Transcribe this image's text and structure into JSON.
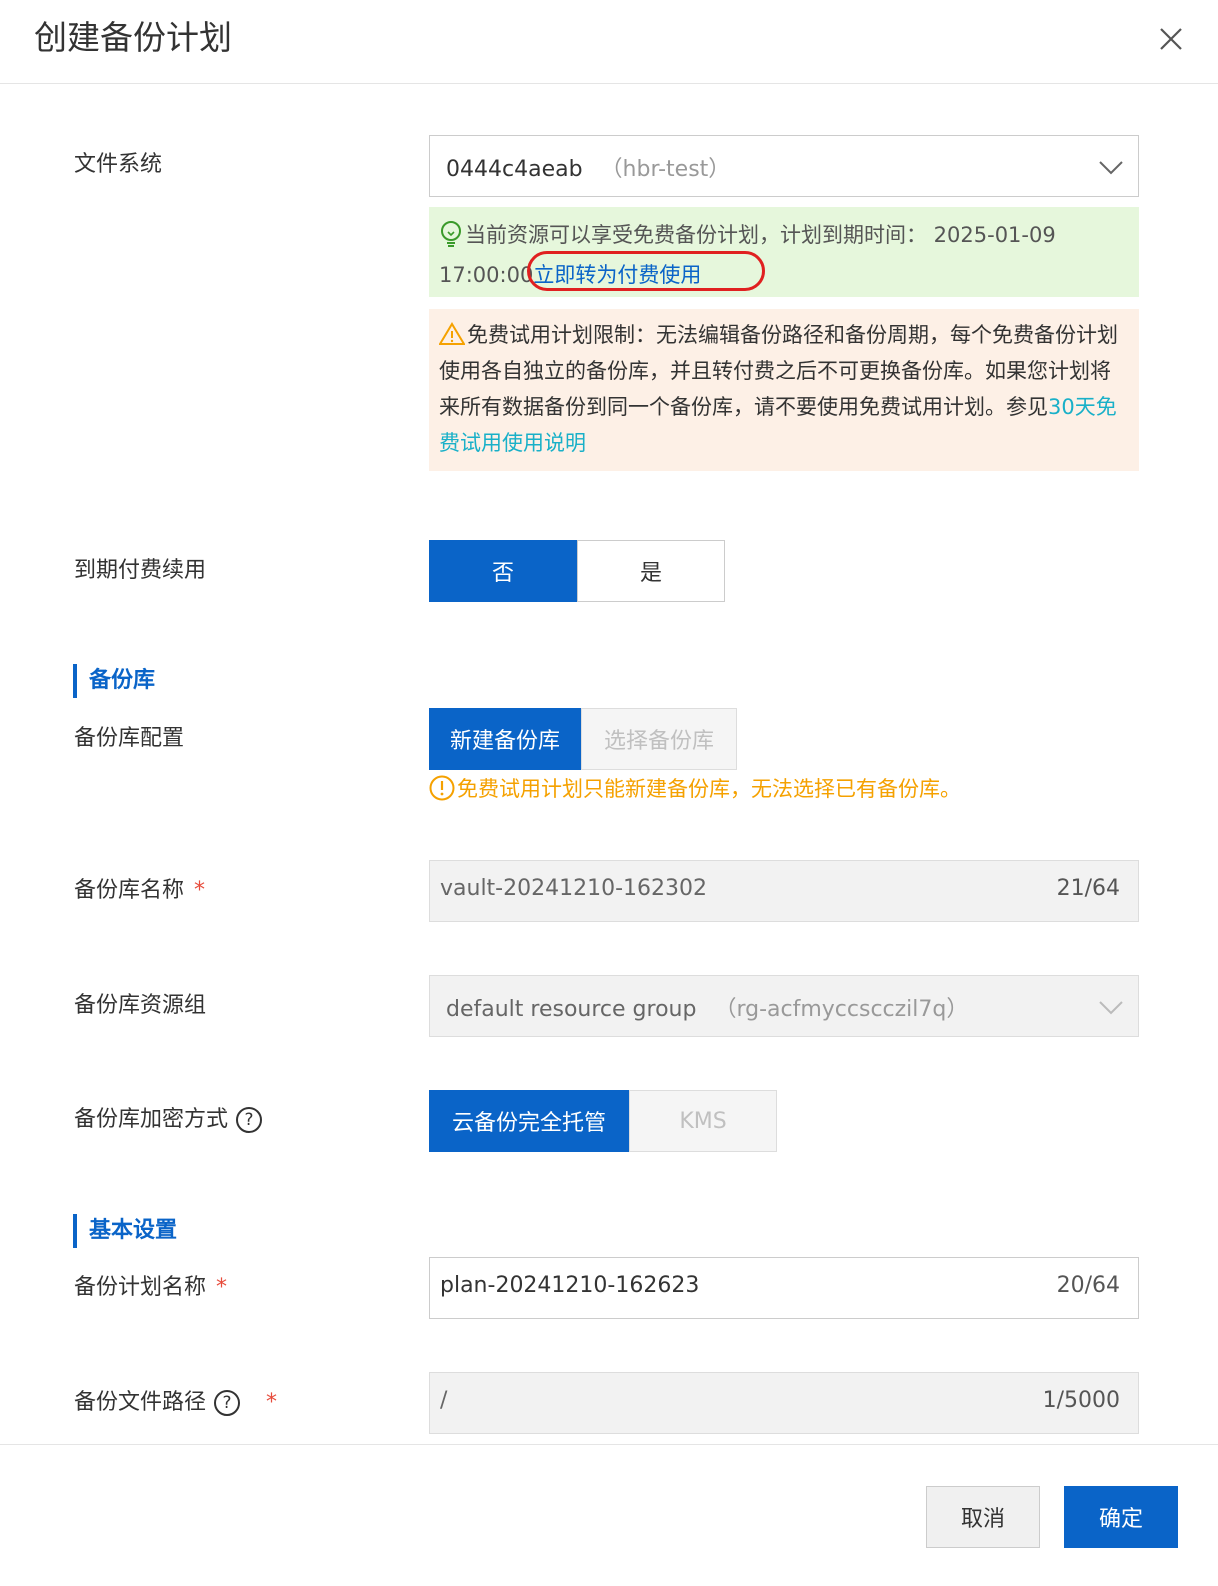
{
  "dialog": {
    "title": "创建备份计划"
  },
  "fields": {
    "file_system": {
      "label": "文件系统",
      "value": "0444c4aeab",
      "sub": "（hbr-test）"
    },
    "free_notice": {
      "text": "当前资源可以享受免费备份计划，计划到期时间： 2025-01-09 17:00:00",
      "link": "立即转为付费使用"
    },
    "limit_notice": {
      "text": "免费试用计划限制：无法编辑备份路径和备份周期，每个免费备份计划使用各自独立的备份库，并且转付费之后不可更换备份库。如果您计划将来所有数据备份到同一个备份库，请不要使用免费试用计划。参见",
      "link": "30天免费试用使用说明"
    },
    "auto_renew": {
      "label": "到期付费续用",
      "options": [
        "否",
        "是"
      ],
      "selected": "否"
    }
  },
  "vault_section": {
    "title": "备份库",
    "config": {
      "label": "备份库配置",
      "options": [
        "新建备份库",
        "选择备份库"
      ],
      "selected": "新建备份库"
    },
    "hint": "免费试用计划只能新建备份库，无法选择已有备份库。",
    "name": {
      "label": "备份库名称",
      "required": "*",
      "value": "vault-20241210-162302",
      "count": "21/64"
    },
    "resource_group": {
      "label": "备份库资源组",
      "value": "default resource group",
      "sub": "（rg-acfmyccscczil7q）"
    },
    "encryption": {
      "label": "备份库加密方式",
      "help": "?",
      "options": [
        "云备份完全托管",
        "KMS"
      ],
      "selected": "云备份完全托管"
    }
  },
  "basic_section": {
    "title": "基本设置",
    "plan_name": {
      "label": "备份计划名称",
      "required": "*",
      "value": "plan-20241210-162623",
      "count": "20/64"
    },
    "path": {
      "label": "备份文件路径",
      "help": "?",
      "required": "*",
      "value": "/",
      "count": "1/5000"
    }
  },
  "footer": {
    "cancel": "取消",
    "ok": "确定"
  },
  "colors": {
    "primary": "#0a64c8",
    "required": "#e74c3c",
    "warning": "#f5a100",
    "highlight_circle": "#e02020"
  }
}
